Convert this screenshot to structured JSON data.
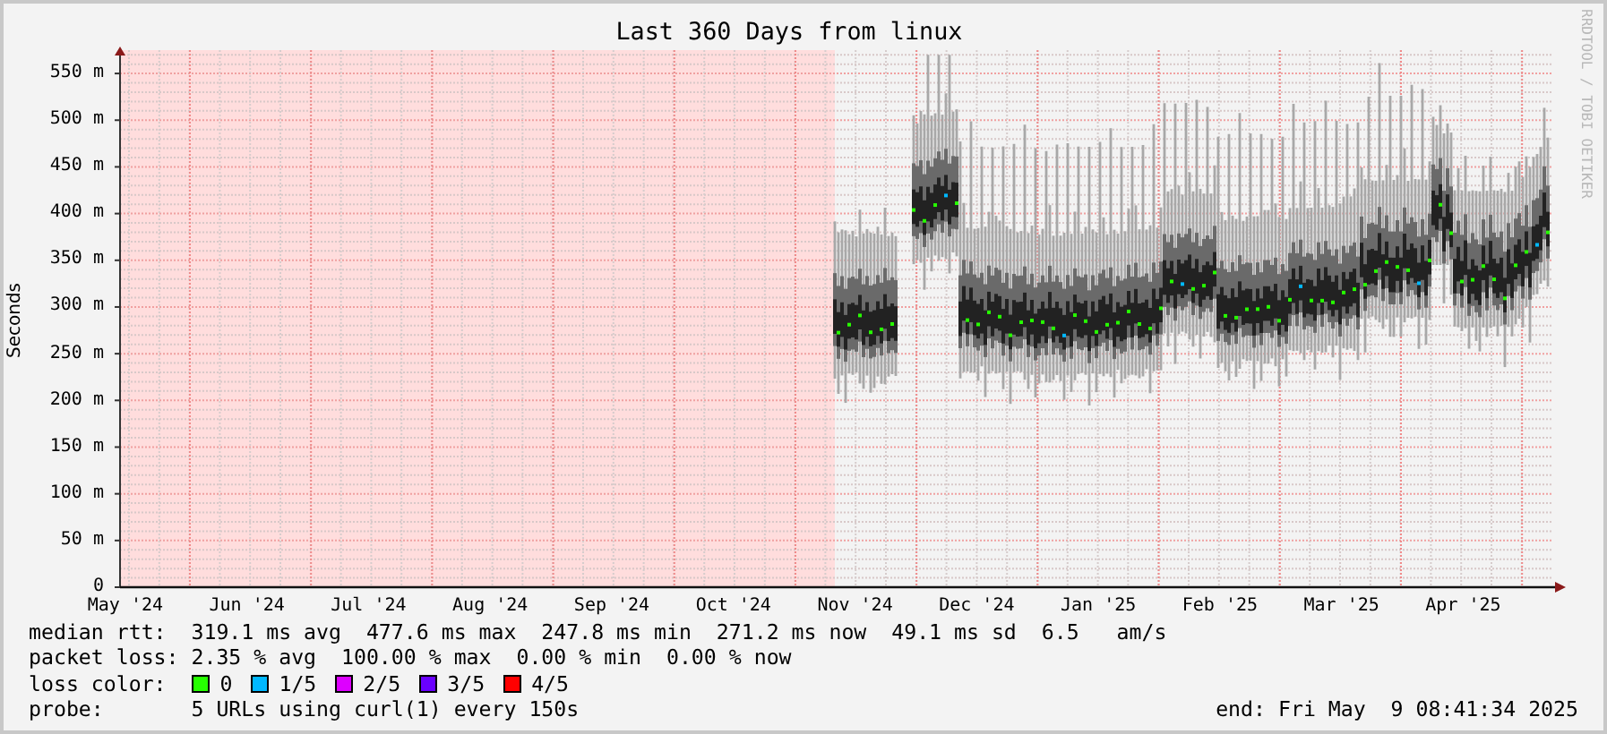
{
  "title": "Last 360 Days from linux",
  "credit": "RRDTOOL / TOBI OETIKER",
  "y_axis": {
    "title": "Seconds",
    "ticks": [
      "550 m",
      "500 m",
      "450 m",
      "400 m",
      "350 m",
      "300 m",
      "250 m",
      "200 m",
      "150 m",
      "100 m",
      "50 m",
      "0"
    ]
  },
  "x_axis": {
    "ticks": [
      "May '24",
      "Jun '24",
      "Jul '24",
      "Aug '24",
      "Sep '24",
      "Oct '24",
      "Nov '24",
      "Dec '24",
      "Jan '25",
      "Feb '25",
      "Mar '25",
      "Apr '25"
    ]
  },
  "stats": [
    {
      "label": "median rtt:",
      "text": "319.1 ms avg  477.6 ms max  247.8 ms min  271.2 ms now  49.1 ms sd  6.5   am/s"
    },
    {
      "label": "packet loss:",
      "text": "2.35 % avg  100.00 % max  0.00 % min  0.00 % now"
    }
  ],
  "loss_color": {
    "label": "loss color:",
    "items": [
      {
        "label": "0",
        "color": "#26ff00"
      },
      {
        "label": "1/5",
        "color": "#00b8ff"
      },
      {
        "label": "2/5",
        "color": "#dd00ff"
      },
      {
        "label": "3/5",
        "color": "#6a00ff"
      },
      {
        "label": "4/5",
        "color": "#ff0000"
      }
    ]
  },
  "probe": {
    "label": "probe:",
    "text": "5 URLs using curl(1) every 150s"
  },
  "end": "end: Fri May  9 08:41:34 2025"
}
